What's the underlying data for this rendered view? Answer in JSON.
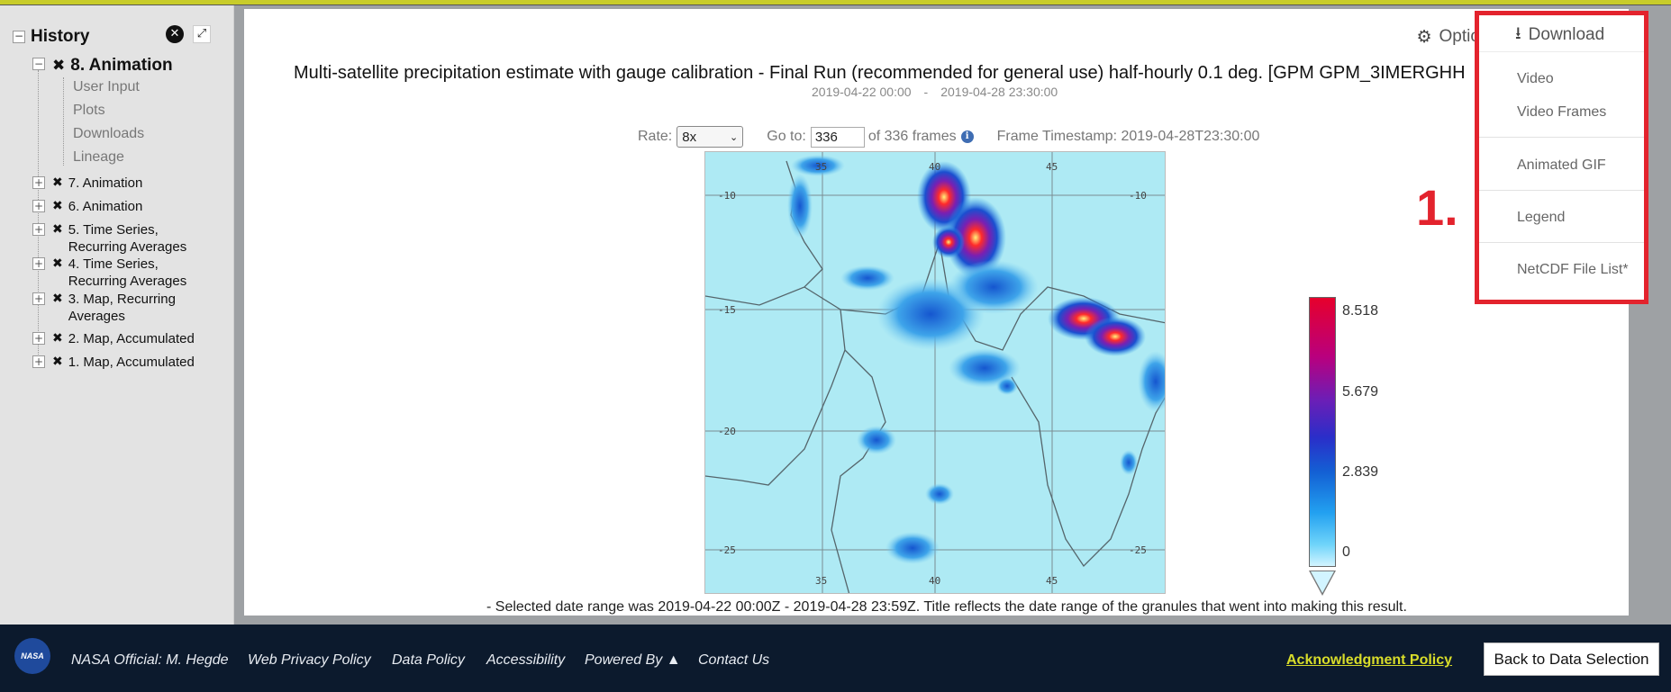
{
  "history": {
    "title": "History",
    "active": {
      "label": "8. Animation",
      "children": [
        "User Input",
        "Plots",
        "Downloads",
        "Lineage"
      ]
    },
    "items": [
      "7. Animation",
      "6. Animation",
      "5. Time Series, Recurring Averages",
      "4. Time Series, Recurring Averages",
      "3. Map, Recurring Averages",
      "2. Map, Accumulated",
      "1. Map, Accumulated"
    ]
  },
  "toolbar": {
    "options_label": "Options",
    "download_label": "Download"
  },
  "download_menu": [
    "Video",
    "Video Frames",
    "Animated GIF",
    "Legend",
    "NetCDF File List*"
  ],
  "annotation": "1.",
  "plot": {
    "title": "Multi-satellite precipitation estimate with gauge calibration - Final Run (recommended for general use) half-hourly 0.1 deg. [GPM GPM_3IMERGHH",
    "date_start": "2019-04-22 00:00",
    "date_sep": "-",
    "date_end": "2019-04-28 23:30:00"
  },
  "controls": {
    "rate_label": "Rate:",
    "rate_value": "8x",
    "goto_label": "Go to:",
    "goto_value": "336",
    "frames_text": "of 336 frames",
    "timestamp_text": "Frame Timestamp: 2019-04-28T23:30:00"
  },
  "map": {
    "lat_labels": [
      "-10",
      "-15",
      "-20",
      "-25"
    ],
    "lon_labels": [
      "35",
      "40",
      "45"
    ]
  },
  "legend": {
    "ticks": [
      "8.518",
      "5.679",
      "2.839",
      "0"
    ]
  },
  "caption": "- Selected date range was 2019-04-22 00:00Z - 2019-04-28 23:59Z. Title reflects the date range of the granules that went into making this result.",
  "footer": {
    "logo_text": "NASA",
    "links": [
      "NASA Official: M. Hegde",
      "Web Privacy Policy",
      "Data Policy",
      "Accessibility",
      "Powered By ▲",
      "Contact Us"
    ],
    "acknowledgment": "Acknowledgment Policy",
    "back_button": "Back to Data Selection"
  }
}
